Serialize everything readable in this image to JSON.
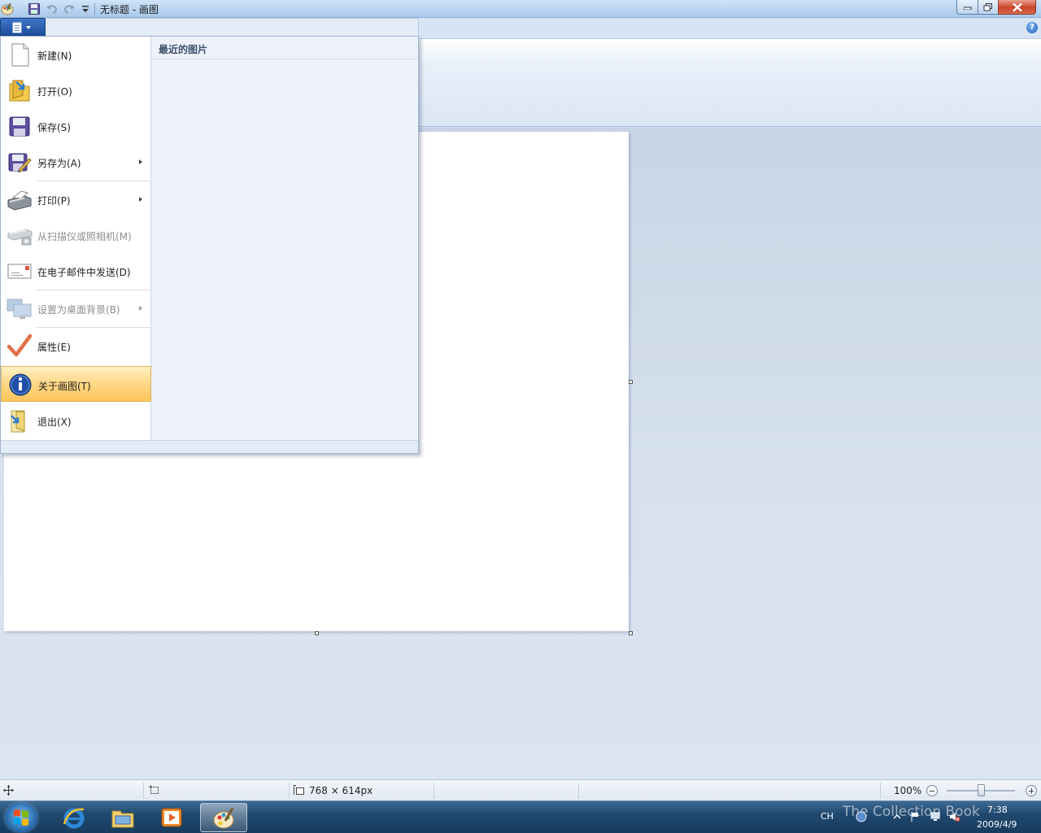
{
  "window": {
    "title": "无标题 - 画图"
  },
  "ribbon": {
    "help_label": "?"
  },
  "file_menu": {
    "items": [
      {
        "label": "新建(N)",
        "icon": "new-document-icon",
        "enabled": true,
        "submenu": false
      },
      {
        "label": "打开(O)",
        "icon": "open-folder-icon",
        "enabled": true,
        "submenu": false
      },
      {
        "label": "保存(S)",
        "icon": "save-disk-icon",
        "enabled": true,
        "submenu": false
      },
      {
        "label": "另存为(A)",
        "icon": "save-as-icon",
        "enabled": true,
        "submenu": true
      },
      {
        "label": "打印(P)",
        "icon": "printer-icon",
        "enabled": true,
        "submenu": true
      },
      {
        "label": "从扫描仪或照相机(M)",
        "icon": "scanner-icon",
        "enabled": false,
        "submenu": false
      },
      {
        "label": "在电子邮件中发送(D)",
        "icon": "email-icon",
        "enabled": true,
        "submenu": false
      },
      {
        "label": "设置为桌面背景(B)",
        "icon": "desktop-background-icon",
        "enabled": false,
        "submenu": true
      },
      {
        "label": "属性(E)",
        "icon": "checkmark-icon",
        "enabled": true,
        "submenu": false
      },
      {
        "label": "关于画图(T)",
        "icon": "info-icon",
        "enabled": true,
        "submenu": false,
        "highlighted": true
      },
      {
        "label": "退出(X)",
        "icon": "exit-icon",
        "enabled": true,
        "submenu": false
      }
    ],
    "recent_title": "最近的图片"
  },
  "status_bar": {
    "image_size": "768 × 614px",
    "zoom": "100%",
    "zoom_level_fraction": 0.5
  },
  "taskbar": {
    "apps": [
      {
        "name": "internet-explorer",
        "icon": "ie-icon",
        "active": false
      },
      {
        "name": "windows-explorer",
        "icon": "explorer-folder-icon",
        "active": false
      },
      {
        "name": "media-player",
        "icon": "media-player-icon",
        "active": false
      },
      {
        "name": "paint",
        "icon": "paint-palette-icon",
        "active": true
      }
    ],
    "language": "CH",
    "time": "7:38",
    "date": "2009/4/9",
    "watermark": "The Collection Book"
  },
  "colors": {
    "accent": "#1c4f9d",
    "menu_highlight": "#ffd98b",
    "taskbar": "#21496f"
  }
}
